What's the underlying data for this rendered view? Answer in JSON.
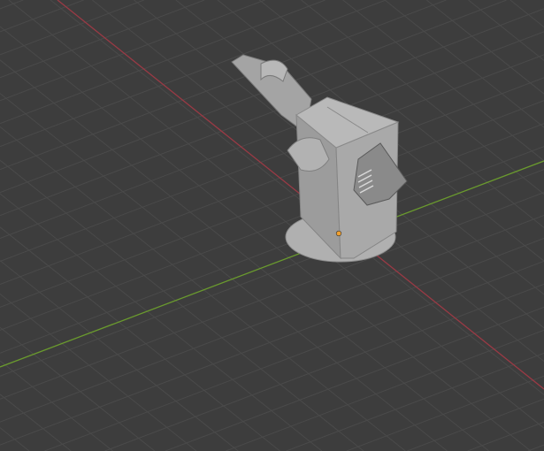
{
  "viewport": {
    "background": "#3d3d3d",
    "grid_color": "#4a4a4a",
    "x_axis_color": "#9a3a45",
    "y_axis_color": "#6a9a2e",
    "model_color": "#a8a8a8",
    "origin_color": "#f0a030"
  }
}
